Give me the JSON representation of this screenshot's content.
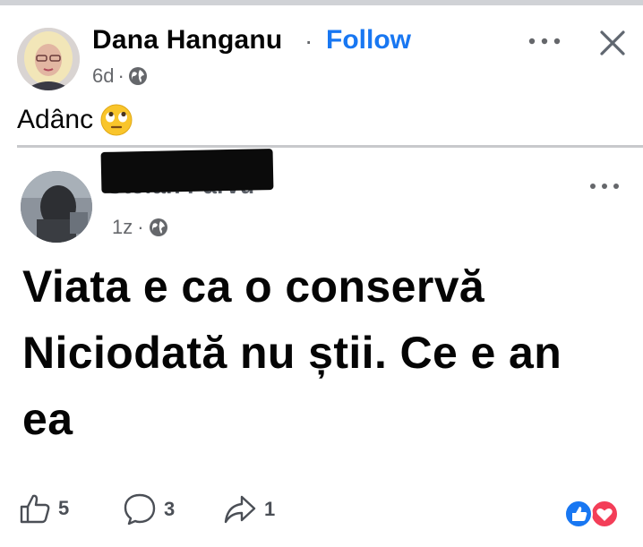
{
  "post": {
    "author": "Dana Hanganu",
    "separator": "·",
    "follow": "Follow",
    "time": "6d",
    "meta_dot": "·",
    "caption": "Adânc"
  },
  "shared": {
    "author": "Stefan Parvu",
    "time": "1z",
    "meta_dot": "·",
    "lines": [
      "Viata e ca o conservă",
      "Niciodată nu știi. Ce e an",
      "ea"
    ]
  },
  "actions": {
    "like_count": "5",
    "comment_count": "3",
    "share_count": "1"
  },
  "colors": {
    "follow": "#1877f2",
    "like_reaction": "#1877f2",
    "love_reaction": "#f33e58"
  },
  "icons": [
    "globe-icon",
    "more-icon",
    "close-icon",
    "eye-roll-emoji",
    "like-icon",
    "comment-icon",
    "share-icon",
    "like-reaction-icon",
    "love-reaction-icon"
  ]
}
